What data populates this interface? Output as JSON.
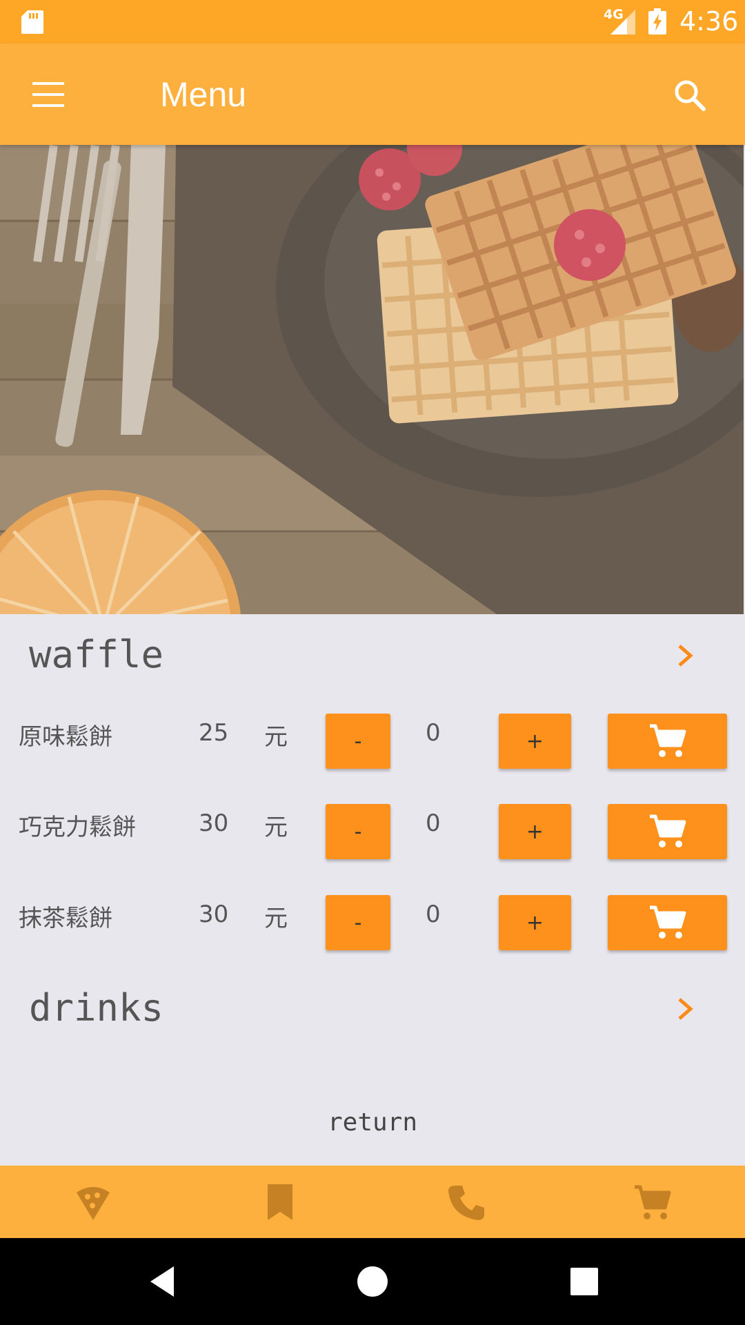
{
  "status_bar": {
    "network_label": "4G",
    "time": "4:36",
    "icons": [
      "sd-card-icon",
      "signal-icon",
      "battery-charging-icon"
    ]
  },
  "app_bar": {
    "title": "Menu",
    "icons": [
      "menu-icon",
      "search-icon"
    ]
  },
  "hero": {
    "image": "waffles-plate-photo"
  },
  "sections": [
    {
      "title": "waffle",
      "items": [
        {
          "name": "原味鬆餅",
          "price": "25",
          "unit": "元",
          "minus_label": "-",
          "quantity": "0",
          "plus_label": "+"
        },
        {
          "name": "巧克力鬆餅",
          "price": "30",
          "unit": "元",
          "minus_label": "-",
          "quantity": "0",
          "plus_label": "+"
        },
        {
          "name": "抹茶鬆餅",
          "price": "30",
          "unit": "元",
          "minus_label": "-",
          "quantity": "0",
          "plus_label": "+"
        }
      ]
    },
    {
      "title": "drinks",
      "items": []
    }
  ],
  "return_label": "return",
  "bottom_nav": {
    "items": [
      "pizza-icon",
      "bookmark-icon",
      "phone-icon",
      "cart-icon"
    ]
  },
  "colors": {
    "status_bar": "#fea626",
    "app_bar": "#feb03e",
    "button": "#fd911c",
    "chevron": "#fd8a17",
    "background": "#e9e7ee",
    "nav_icon": "#c58124"
  }
}
